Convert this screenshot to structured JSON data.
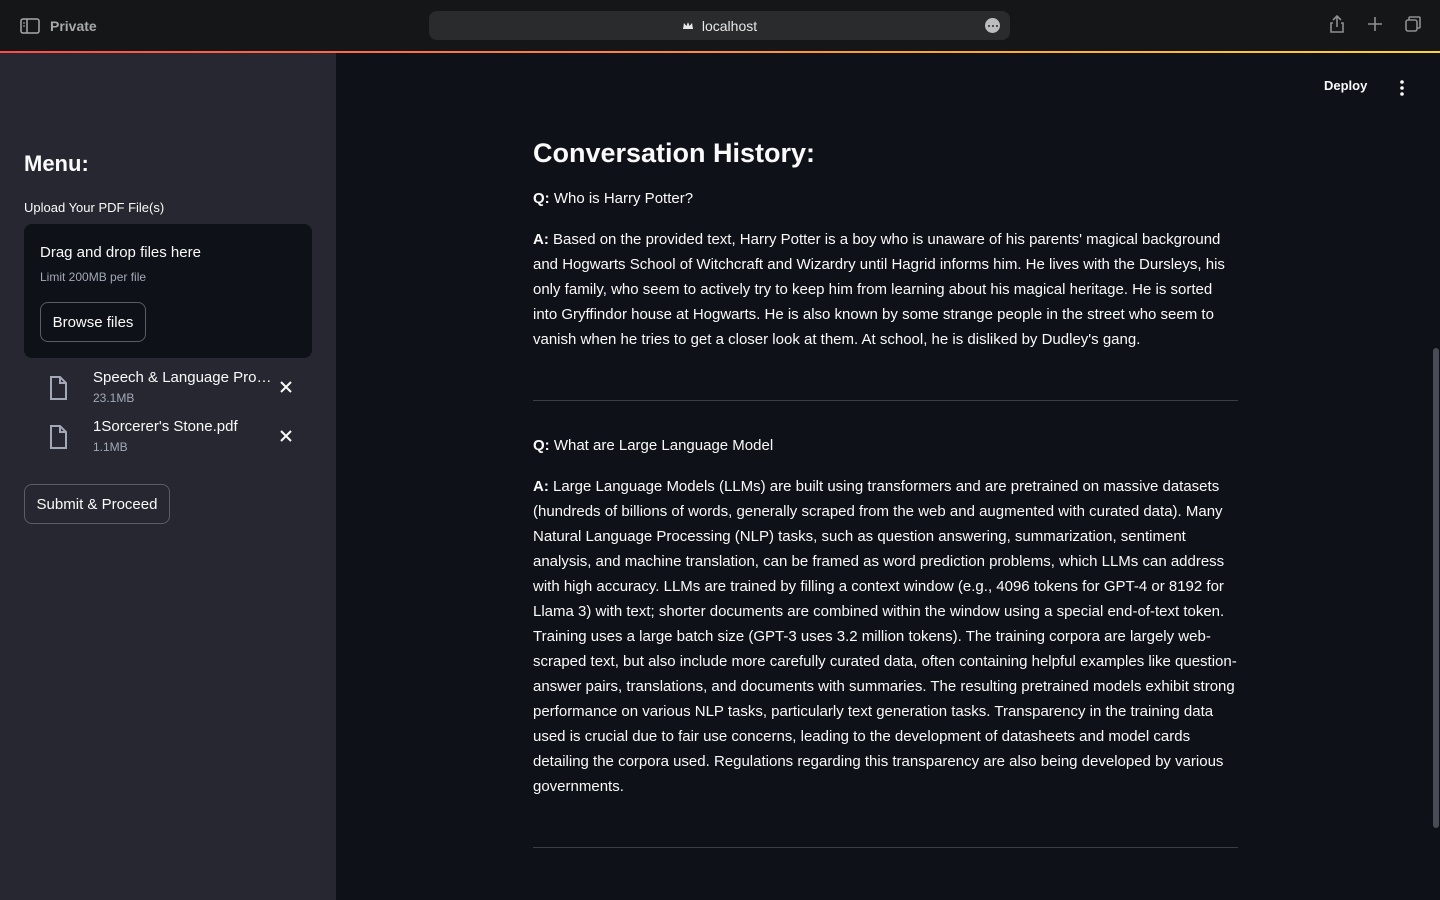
{
  "browser": {
    "mode_label": "Private",
    "url": "localhost"
  },
  "app": {
    "deploy_label": "Deploy",
    "accent_gradient": [
      "#ff4b4b",
      "#ff8c3a",
      "#ffd23f"
    ]
  },
  "sidebar": {
    "menu_title": "Menu:",
    "upload_label": "Upload Your PDF File(s)",
    "dropzone": {
      "title": "Drag and drop files here",
      "limit": "Limit 200MB per file",
      "browse_label": "Browse files"
    },
    "files": [
      {
        "name": "Speech & Language Processing.pdf",
        "size": "23.1MB"
      },
      {
        "name": "1Sorcerer's Stone.pdf",
        "size": "1.1MB"
      }
    ],
    "submit_label": "Submit & Proceed"
  },
  "main": {
    "title": "Conversation History:",
    "q_prefix": "Q:",
    "a_prefix": "A:",
    "conversation": [
      {
        "question": "Who is Harry Potter?",
        "answer": "Based on the provided text, Harry Potter is a boy who is unaware of his parents' magical background and Hogwarts School of Witchcraft and Wizardry until Hagrid informs him. He lives with the Dursleys, his only family, who seem to actively try to keep him from learning about his magical heritage. He is sorted into Gryffindor house at Hogwarts. He is also known by some strange people in the street who seem to vanish when he tries to get a closer look at them. At school, he is disliked by Dudley's gang."
      },
      {
        "question": "What are Large Language Model",
        "answer": "Large Language Models (LLMs) are built using transformers and are pretrained on massive datasets (hundreds of billions of words, generally scraped from the web and augmented with curated data). Many Natural Language Processing (NLP) tasks, such as question answering, summarization, sentiment analysis, and machine translation, can be framed as word prediction problems, which LLMs can address with high accuracy. LLMs are trained by filling a context window (e.g., 4096 tokens for GPT-4 or 8192 for Llama 3) with text; shorter documents are combined within the window using a special end-of-text token. Training uses a large batch size (GPT-3 uses 3.2 million tokens). The training corpora are largely web-scraped text, but also include more carefully curated data, often containing helpful examples like question-answer pairs, translations, and documents with summaries. The resulting pretrained models exhibit strong performance on various NLP tasks, particularly text generation tasks. Transparency in the training data used is crucial due to fair use concerns, leading to the development of datasheets and model cards detailing the corpora used. Regulations regarding this transparency are also being developed by various governments."
      }
    ]
  }
}
